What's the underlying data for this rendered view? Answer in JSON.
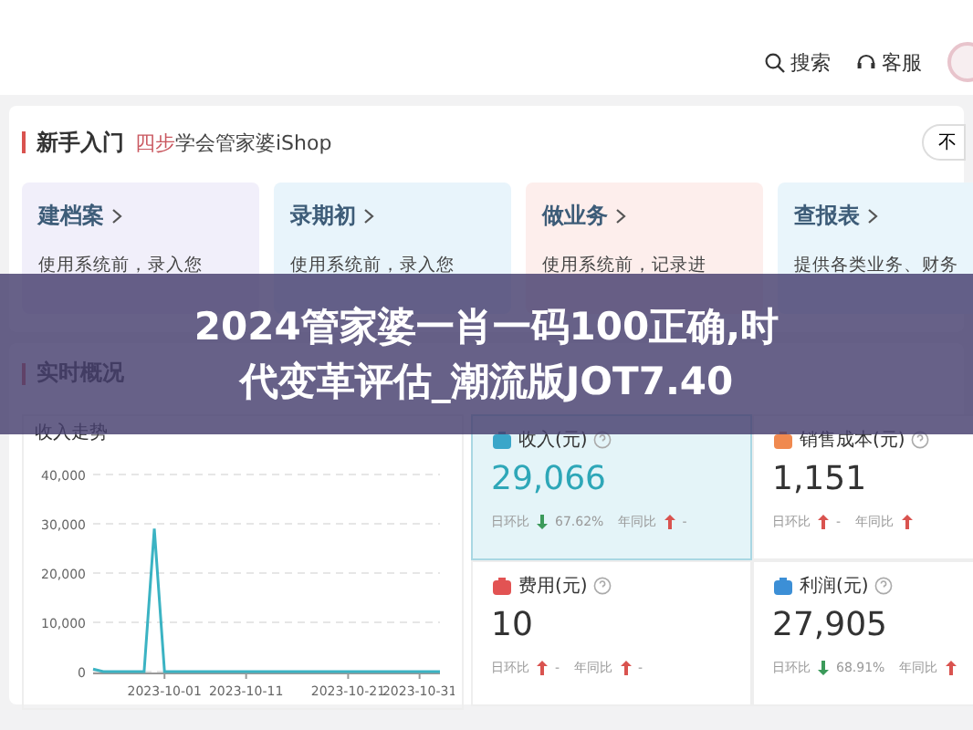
{
  "topbar": {
    "actions": [
      {
        "kind": "search",
        "label": "搜索"
      },
      {
        "kind": "service",
        "label": "客服"
      }
    ]
  },
  "intro": {
    "title": "新手入门",
    "subtitle_highlight": "四步",
    "subtitle_rest": "学会管家婆iShop",
    "side_button": "不",
    "steps": [
      {
        "title": "建档案",
        "text": "使用系统前，录入您",
        "color": "#f1effa"
      },
      {
        "title": "录期初",
        "text": "使用系统前，录入您",
        "color": "#e8f4fb"
      },
      {
        "title": "做业务",
        "text": "使用系统前，记录进",
        "color": "#fdeeec"
      },
      {
        "title": "查报表",
        "text": "提供各类业务、财务",
        "color": "#e9f5fb"
      }
    ]
  },
  "banner": {
    "lines": [
      "2024管家婆一肖一码100正确,时",
      "代变革评估_潮流版JOT7.40"
    ]
  },
  "overview": {
    "title": "实时概况",
    "trend": {
      "title": "收入走势",
      "chart_data": {
        "type": "line",
        "categories": [
          null,
          null,
          null,
          null,
          null,
          null,
          null,
          "2023-10-01",
          null,
          null,
          null,
          null,
          null,
          null,
          null,
          "2023-10-11",
          null,
          null,
          null,
          null,
          null,
          null,
          null,
          null,
          null,
          "2023-10-21",
          null,
          null,
          null,
          null,
          null,
          null,
          "2023-10-31",
          null,
          null
        ],
        "series": [
          {
            "color": "#3bb3c3",
            "values": [
              500,
              0,
              0,
              0,
              0,
              0,
              29000,
              0,
              0,
              0,
              0,
              0,
              0,
              0,
              0,
              0,
              0,
              0,
              0,
              0,
              0,
              0,
              0,
              0,
              0,
              0,
              0,
              0,
              0,
              0,
              0,
              0,
              0,
              0,
              0
            ]
          }
        ],
        "grid": true,
        "ylim": [
          0,
          40000
        ],
        "yticks": [
          {
            "value": 0,
            "label": "0"
          },
          {
            "value": 10000,
            "label": "10,000"
          },
          {
            "value": 20000,
            "label": "20,000"
          },
          {
            "value": 30000,
            "label": "30,000"
          },
          {
            "value": 40000,
            "label": "40,000"
          }
        ]
      }
    },
    "kpis": [
      {
        "kind": "income",
        "title": "收入(元)",
        "value": "29,066",
        "selected": true,
        "compare": [
          {
            "label": "日环比",
            "up": false,
            "reading": "67.62%"
          },
          {
            "label": "年同比",
            "up": true,
            "reading": "-"
          }
        ]
      },
      {
        "kind": "cost",
        "title": "销售成本(元)",
        "value": "1,151",
        "selected": false,
        "compare": [
          {
            "label": "日环比",
            "up": true,
            "reading": "-"
          },
          {
            "label": "年同比",
            "up": true
          }
        ]
      },
      {
        "kind": "expense",
        "title": "费用(元)",
        "value": "10",
        "selected": false,
        "compare": [
          {
            "label": "日环比",
            "up": true,
            "reading": "-"
          },
          {
            "label": "年同比",
            "up": true,
            "reading": "-"
          }
        ]
      },
      {
        "kind": "profit",
        "title": "利润(元)",
        "value": "27,905",
        "selected": false,
        "compare": [
          {
            "label": "日环比",
            "up": false,
            "reading": "68.91%"
          },
          {
            "label": "年同比",
            "up": true
          }
        ]
      }
    ]
  }
}
